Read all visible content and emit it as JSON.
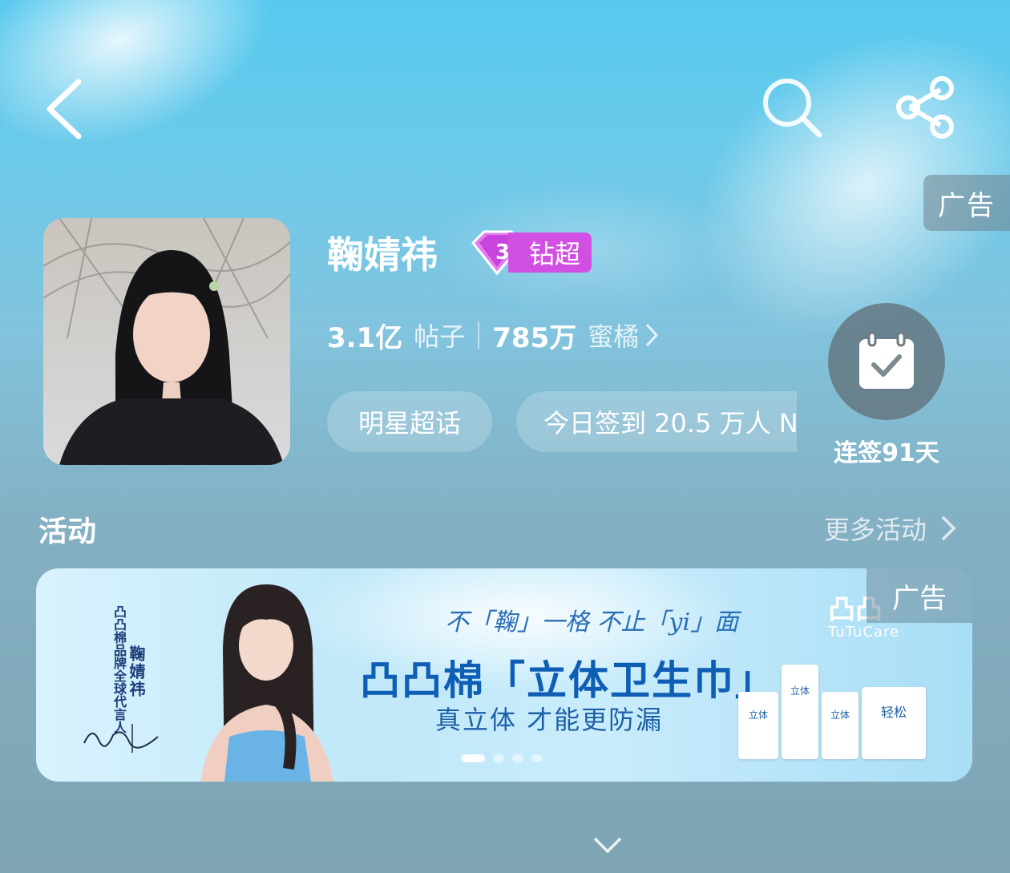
{
  "header": {
    "back_icon": "chevron-left-icon",
    "search_icon": "search-icon",
    "share_icon": "share-icon",
    "ad_label": "广告"
  },
  "profile": {
    "name": "鞠婧祎",
    "level_number": "3",
    "level_label": "钻超",
    "posts_count": "3.1亿",
    "posts_label": "帖子",
    "fans_count": "785万",
    "fans_label": "蜜橘",
    "category_pill": "明星超话",
    "checkin_pill": "今日签到 20.5 万人 N",
    "checkin_icon": "calendar-check-icon",
    "checkin_streak": "连签91天"
  },
  "activity": {
    "title": "活动",
    "more_label": "更多活动",
    "banner": {
      "ad_label": "广告",
      "side_text_1": "凸凸棉品牌全球代言人",
      "side_text_2": "鞠婧祎",
      "slogan": "不「鞠」一格 不止「yi」面",
      "headline": "凸凸棉「立体卫生巾」",
      "subline": "真立体 才能更防漏",
      "brand_logo": "凸凸",
      "brand_name": "TuTuCare",
      "product_labels": [
        "立体",
        "立体",
        "立体",
        "轻松"
      ],
      "dots_count": 4,
      "active_dot": 0
    }
  },
  "footer": {
    "expand_icon": "chevron-down-icon"
  },
  "colors": {
    "level_badge": "#d24fe3",
    "banner_text": "#0e5eb6"
  }
}
